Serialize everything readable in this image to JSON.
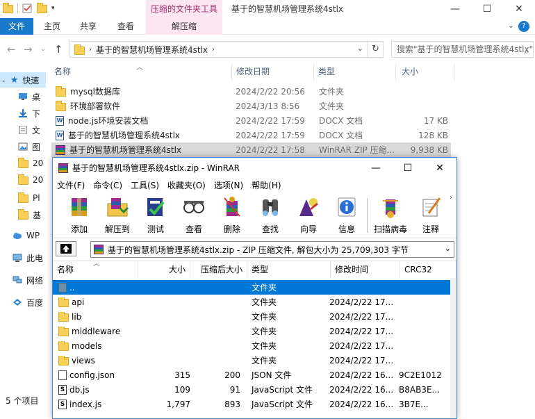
{
  "explorer": {
    "context_tab_title": "压缩的文件夹工具",
    "window_title": "基于的智慧机场管理系统4stlx",
    "ribbon": {
      "file": "文件",
      "home": "主页",
      "share": "共享",
      "view": "查看",
      "extract": "解压缩"
    },
    "address": {
      "path_segment": "基于的智慧机场管理系统4stlx",
      "search_placeholder": "搜索\"基于的智慧机场管理系统4stlx\""
    },
    "nav": [
      {
        "label": "快速",
        "icon": "star-icon"
      },
      {
        "label": "桌",
        "icon": "desktop-icon"
      },
      {
        "label": "下",
        "icon": "download-icon"
      },
      {
        "label": "文",
        "icon": "document-icon"
      },
      {
        "label": "图",
        "icon": "picture-icon"
      },
      {
        "label": "20",
        "icon": "folder-icon"
      },
      {
        "label": "20",
        "icon": "folder-icon"
      },
      {
        "label": "Pl",
        "icon": "folder-icon"
      },
      {
        "label": "基",
        "icon": "folder-icon"
      },
      {
        "label": "WP",
        "icon": "cloud-icon"
      },
      {
        "label": "此电",
        "icon": "computer-icon"
      },
      {
        "label": "网络",
        "icon": "network-icon"
      },
      {
        "label": "百度",
        "icon": "baidu-icon"
      }
    ],
    "columns": {
      "name": "名称",
      "modified": "修改日期",
      "type": "类型",
      "size": "大小"
    },
    "files": [
      {
        "name": "mysql数据库",
        "modified": "2024/2/22 20:56",
        "type": "文件夹",
        "size": "",
        "icon": "folder"
      },
      {
        "name": "环境部署软件",
        "modified": "2024/3/13 8:56",
        "type": "文件夹",
        "size": "",
        "icon": "folder"
      },
      {
        "name": "node.js环境安装文档",
        "modified": "2024/2/22 17:59",
        "type": "DOCX 文档",
        "size": "17 KB",
        "icon": "docx"
      },
      {
        "name": "基于的智慧机场管理系统4stlx",
        "modified": "2024/2/22 17:59",
        "type": "DOCX 文档",
        "size": "128 KB",
        "icon": "docx"
      },
      {
        "name": "基于的智慧机场管理系统4stlx",
        "modified": "2024/2/22 17:58",
        "type": "WinRAR ZIP 压缩...",
        "size": "9,938 KB",
        "icon": "rar"
      }
    ],
    "status": "5 个项目"
  },
  "winrar": {
    "title": "基于的智慧机场管理系统4stlx.zip - WinRAR",
    "menu": [
      "文件(F)",
      "命令(C)",
      "工具(S)",
      "收藏夹(O)",
      "选项(N)",
      "帮助(H)"
    ],
    "tools": [
      {
        "label": "添加",
        "icon": "add-archive-icon"
      },
      {
        "label": "解压到",
        "icon": "extract-to-icon"
      },
      {
        "label": "测试",
        "icon": "test-icon"
      },
      {
        "label": "查看",
        "icon": "view-icon"
      },
      {
        "label": "删除",
        "icon": "delete-icon"
      },
      {
        "label": "查找",
        "icon": "find-icon"
      },
      {
        "label": "向导",
        "icon": "wizard-icon"
      },
      {
        "label": "信息",
        "icon": "info-icon"
      },
      {
        "label": "扫描病毒",
        "icon": "virus-scan-icon"
      },
      {
        "label": "注释",
        "icon": "comment-icon"
      }
    ],
    "path_text": "基于的智慧机场管理系统4stlx.zip - ZIP 压缩文件, 解包大小为 25,709,303 字节",
    "columns": {
      "name": "名称",
      "size": "大小",
      "packed": "压缩后大小",
      "type": "类型",
      "modified": "修改时间",
      "crc": "CRC32"
    },
    "rows": [
      {
        "name": "..",
        "size": "",
        "packed": "",
        "type": "文件夹",
        "modified": "",
        "crc": "",
        "icon": "up"
      },
      {
        "name": "api",
        "size": "",
        "packed": "",
        "type": "文件夹",
        "modified": "2024/2/22 17...",
        "crc": "",
        "icon": "folder"
      },
      {
        "name": "lib",
        "size": "",
        "packed": "",
        "type": "文件夹",
        "modified": "2024/2/22 17...",
        "crc": "",
        "icon": "folder"
      },
      {
        "name": "middleware",
        "size": "",
        "packed": "",
        "type": "文件夹",
        "modified": "2024/2/22 17...",
        "crc": "",
        "icon": "folder"
      },
      {
        "name": "models",
        "size": "",
        "packed": "",
        "type": "文件夹",
        "modified": "2024/2/22 17...",
        "crc": "",
        "icon": "folder"
      },
      {
        "name": "views",
        "size": "",
        "packed": "",
        "type": "文件夹",
        "modified": "2024/2/22 17...",
        "crc": "",
        "icon": "folder"
      },
      {
        "name": "config.json",
        "size": "315",
        "packed": "200",
        "type": "JSON 文件",
        "modified": "2024/2/22 16...",
        "crc": "9C2E1012",
        "icon": "json"
      },
      {
        "name": "db.js",
        "size": "109",
        "packed": "91",
        "type": "JavaScript 文件",
        "modified": "2024/2/22 16...",
        "crc": "B8AB3E...",
        "icon": "js"
      },
      {
        "name": "index.js",
        "size": "1,797",
        "packed": "893",
        "type": "JavaScript 文件",
        "modified": "2024/2/22 16...",
        "crc": "3B7E...",
        "icon": "js"
      }
    ]
  }
}
